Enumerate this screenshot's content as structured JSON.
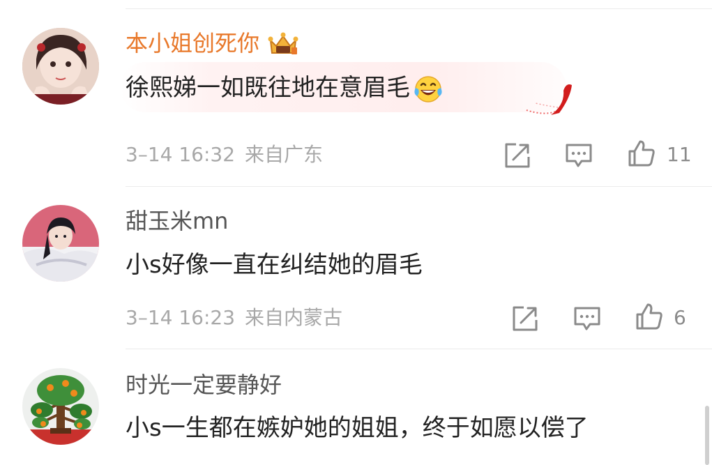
{
  "colors": {
    "vip_name": "#e8782a",
    "normal_name": "#555555",
    "body_text": "#222222",
    "meta_text": "#a8a8a8",
    "icon_stroke": "#8a8a8a"
  },
  "comments": [
    {
      "username": "本小姐创死你",
      "is_vip": true,
      "text": "徐熙娣一如既往地在意眉毛",
      "emoji": "laughing-tears-emoji",
      "date": "3–14 16:32",
      "location": "来自广东",
      "likes": "11"
    },
    {
      "username": "甜玉米mn",
      "is_vip": false,
      "text": "小s好像一直在纠结她的眉毛",
      "date": "3–14 16:23",
      "location": "来自内蒙古",
      "likes": "6"
    },
    {
      "username": "时光一定要静好",
      "is_vip": false,
      "text": "小s一生都在嫉妒她的姐姐，终于如愿以偿了"
    }
  ],
  "icons": {
    "share": "share-icon",
    "comment": "comment-icon",
    "like": "like-icon",
    "vip": "vip-crown-icon"
  }
}
